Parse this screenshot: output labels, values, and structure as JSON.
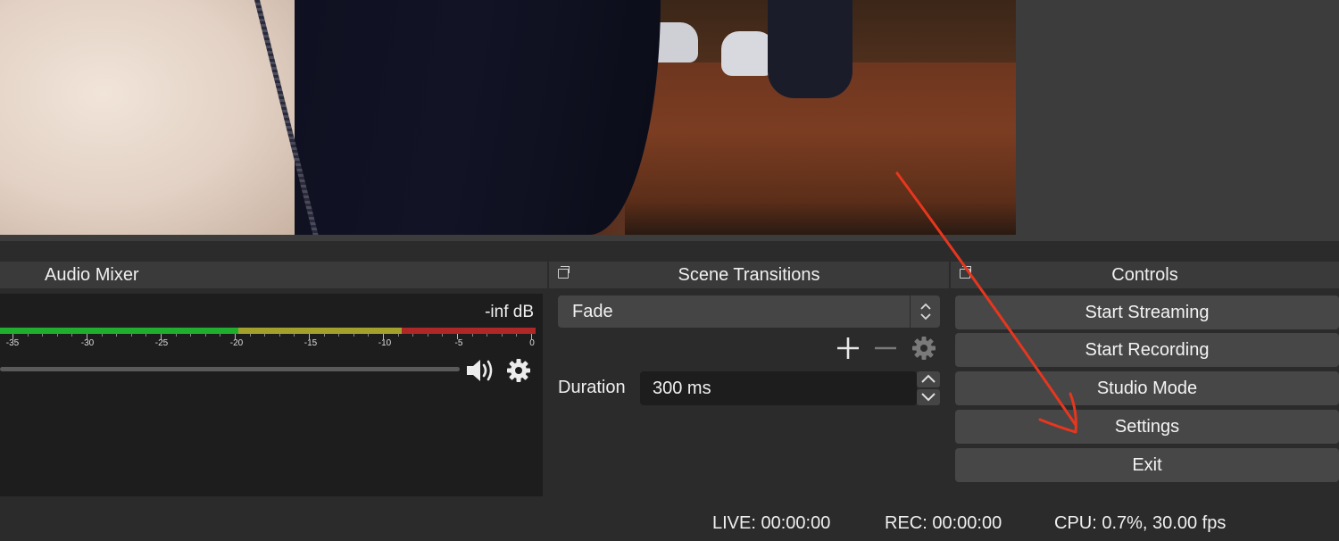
{
  "docks": {
    "audio_mixer": {
      "title": "Audio Mixer",
      "level_text": "-inf dB",
      "scale_labels": [
        "-35",
        "-30",
        "-25",
        "-20",
        "-15",
        "-10",
        "-5",
        "0"
      ],
      "meter_colors": {
        "green": "#1fae2e",
        "yellow": "#a3a12b",
        "red": "#b02727"
      }
    },
    "scene_transitions": {
      "title": "Scene Transitions",
      "selected_transition": "Fade",
      "duration_label": "Duration",
      "duration_value": "300 ms"
    },
    "controls": {
      "title": "Controls",
      "buttons": [
        "Start Streaming",
        "Start Recording",
        "Studio Mode",
        "Settings",
        "Exit"
      ]
    }
  },
  "status_bar": {
    "live": "LIVE: 00:00:00",
    "rec": "REC: 00:00:00",
    "cpu": "CPU: 0.7%, 30.00 fps"
  },
  "icons": {
    "mute": "speaker-icon",
    "mixer_settings": "gear-icon",
    "add_transition": "plus-icon",
    "remove_transition": "minus-icon",
    "transition_properties": "gear-icon",
    "float_dock": "float-window-icon"
  },
  "annotation": {
    "color": "#e8361e"
  }
}
